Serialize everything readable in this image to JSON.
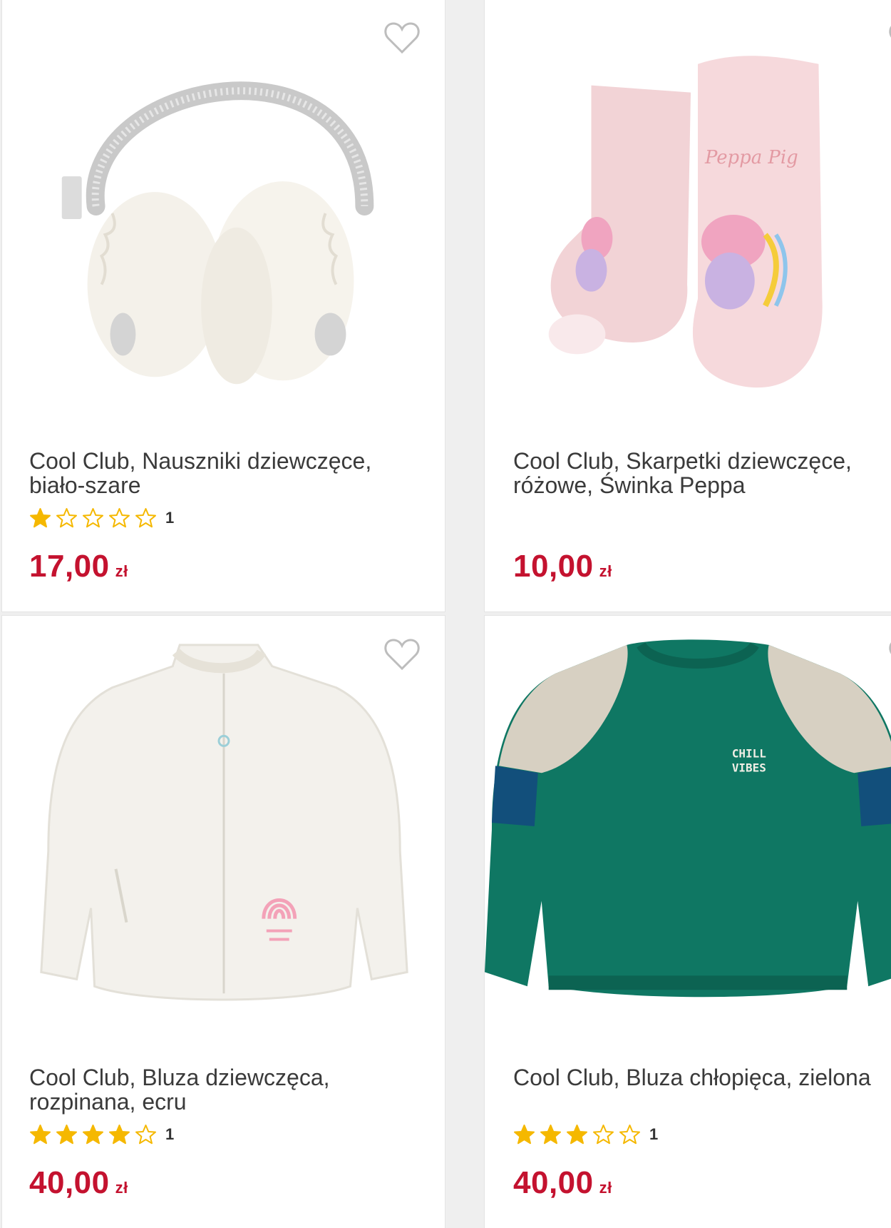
{
  "products": [
    {
      "title_line1": "Cool Club, Nauszniki dziewczęce,",
      "title_line2": "biało-szare",
      "rating": 1,
      "review_count": "1",
      "price": "17,00",
      "currency": "zł",
      "image_icon": "earmuffs-image"
    },
    {
      "title_line1": "Cool Club, Skarpetki dziewczęce,",
      "title_line2": "różowe, Świnka Peppa",
      "rating": null,
      "review_count": "",
      "price": "10,00",
      "currency": "zł",
      "image_icon": "socks-image",
      "image_text": "Peppa Pig"
    },
    {
      "title_line1": "Cool Club, Bluza dziewczęca,",
      "title_line2": "rozpinana, ecru",
      "rating": 4,
      "review_count": "1",
      "price": "40,00",
      "currency": "zł",
      "image_icon": "jacket-image"
    },
    {
      "title_line1": "Cool Club, Bluza chłopięca, zielona",
      "title_line2": "",
      "rating": 3,
      "review_count": "1",
      "price": "40,00",
      "currency": "zł",
      "image_icon": "sweatshirt-image",
      "image_text_1": "CHILL",
      "image_text_2": "VIBES"
    }
  ],
  "colors": {
    "price": "#c4122f",
    "star_filled": "#f5b800",
    "star_empty": "#f5b800"
  }
}
